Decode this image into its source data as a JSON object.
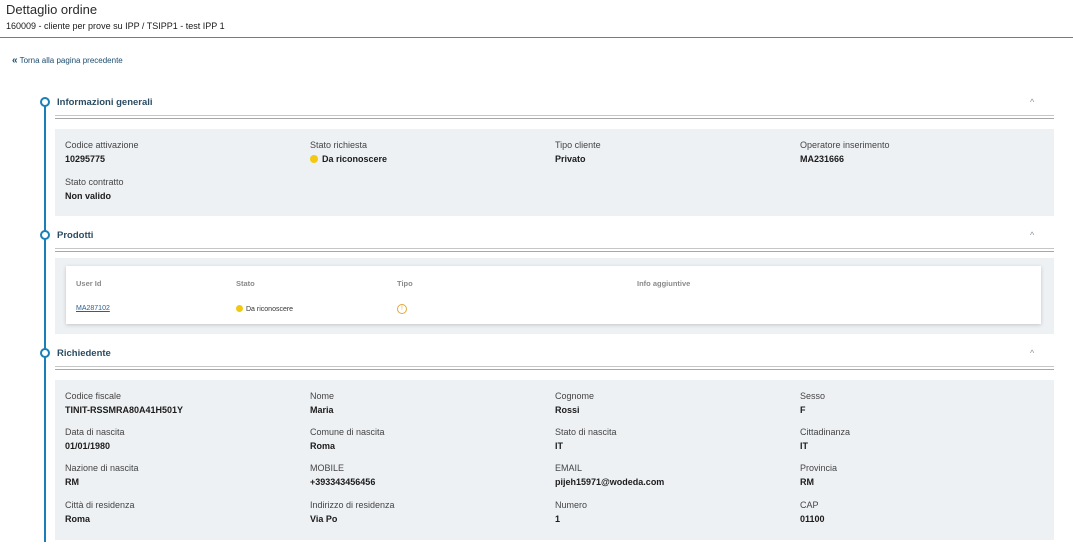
{
  "header": {
    "title": "Dettaglio ordine",
    "subtitle": "160009 - cliente per prove su IPP  / TSIPP1 - test IPP 1"
  },
  "back_link": {
    "chevron": "«",
    "label": "Torna alla pagina precedente"
  },
  "sections": {
    "general": {
      "title": "Informazioni generali",
      "toggle": "^",
      "fields": [
        {
          "label": "Codice attivazione",
          "value": "10295775"
        },
        {
          "label": "Stato richiesta",
          "value": "Da riconoscere"
        },
        {
          "label": "Tipo cliente",
          "value": "Privato"
        },
        {
          "label": "Operatore inserimento",
          "value": "MA231666"
        },
        {
          "label": "Stato contratto",
          "value": "Non valido"
        }
      ]
    },
    "products": {
      "title": "Prodotti",
      "toggle": "^",
      "columns": [
        "User Id",
        "Stato",
        "Tipo",
        "Info aggiuntive"
      ],
      "rows": [
        {
          "user_id": "MA287102",
          "stato": "Da riconoscere",
          "tipo_icon": "info-circle-icon",
          "info": ""
        }
      ]
    },
    "requester": {
      "title": "Richiedente",
      "toggle": "^",
      "fields": [
        {
          "label": "Codice fiscale",
          "value": "TINIT-RSSMRA80A41H501Y"
        },
        {
          "label": "Nome",
          "value": "Maria"
        },
        {
          "label": "Cognome",
          "value": "Rossi"
        },
        {
          "label": "Sesso",
          "value": "F"
        },
        {
          "label": "Data di nascita",
          "value": "01/01/1980"
        },
        {
          "label": "Comune di nascita",
          "value": "Roma"
        },
        {
          "label": "Stato di nascita",
          "value": "IT"
        },
        {
          "label": "Cittadinanza",
          "value": "IT"
        },
        {
          "label": "Nazione di nascita",
          "value": "RM"
        },
        {
          "label": "MOBILE",
          "value": "+393343456456"
        },
        {
          "label": "EMAIL",
          "value": "pijeh15971@wodeda.com"
        },
        {
          "label": "Provincia",
          "value": "RM"
        },
        {
          "label": "Città di residenza",
          "value": "Roma"
        },
        {
          "label": "Indirizzo di residenza",
          "value": "Via Po"
        },
        {
          "label": "Numero",
          "value": "1"
        },
        {
          "label": "CAP",
          "value": "01100"
        }
      ]
    }
  },
  "colors": {
    "accent": "#1a7fb8",
    "status_yellow": "#f2c811",
    "panel_bg": "#eef1f4"
  }
}
